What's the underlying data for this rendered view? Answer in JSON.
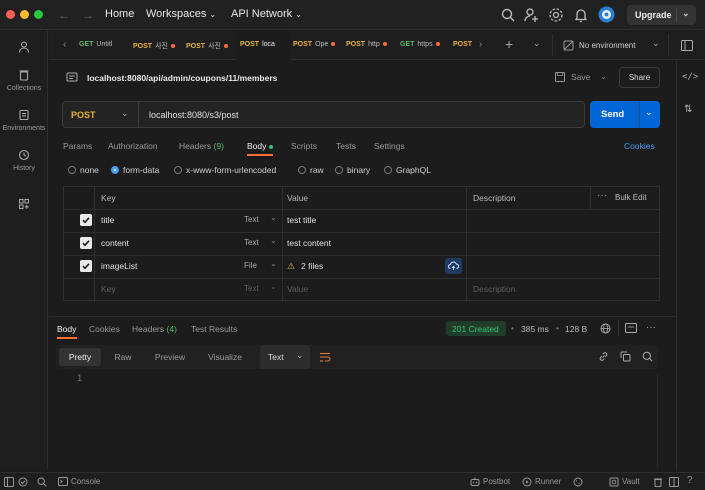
{
  "titlebar": {
    "home": "Home",
    "workspaces": "Workspaces",
    "api_network": "API Network",
    "upgrade": "Upgrade"
  },
  "sidebar": {
    "items": [
      {
        "label": ""
      },
      {
        "label": "Collections"
      },
      {
        "label": "Environments"
      },
      {
        "label": "History"
      },
      {
        "label": ""
      }
    ]
  },
  "tabs": [
    {
      "method": "GET",
      "title": "Untitl",
      "dot": false
    },
    {
      "method": "POST",
      "title": "사진",
      "dot": true
    },
    {
      "method": "POST",
      "title": "사진",
      "dot": true
    },
    {
      "method": "POST",
      "title": "loca",
      "dot": false
    },
    {
      "method": "POST",
      "title": "Ope",
      "dot": true
    },
    {
      "method": "POST",
      "title": "http",
      "dot": true
    },
    {
      "method": "GET",
      "title": "https",
      "dot": true
    },
    {
      "method": "POST",
      "title": "",
      "dot": false
    }
  ],
  "environment": "No environment",
  "request": {
    "path": "localhost:8080/api/admin/coupons/11/members",
    "save": "Save",
    "share": "Share",
    "method": "POST",
    "url": "localhost:8080/s3/post",
    "send": "Send"
  },
  "request_tabs": {
    "params": "Params",
    "authorization": "Authorization",
    "headers": "Headers",
    "headers_count": "(9)",
    "body": "Body",
    "scripts": "Scripts",
    "tests": "Tests",
    "settings": "Settings",
    "cookies": "Cookies"
  },
  "body_types": [
    "none",
    "form-data",
    "x-www-form-urlencoded",
    "raw",
    "binary",
    "GraphQL"
  ],
  "body_selected": "form-data",
  "form_table": {
    "headers": {
      "key": "Key",
      "value": "Value",
      "description": "Description",
      "bulk_edit": "Bulk Edit"
    },
    "rows": [
      {
        "key": "title",
        "type": "Text",
        "value": "test title"
      },
      {
        "key": "content",
        "type": "Text",
        "value": "test content"
      },
      {
        "key": "imageList",
        "type": "File",
        "value": "2 files"
      }
    ],
    "placeholder": {
      "key": "Key",
      "type": "Text",
      "value": "Value",
      "description": "Description"
    }
  },
  "response": {
    "tabs": {
      "body": "Body",
      "cookies": "Cookies",
      "headers": "Headers",
      "headers_count": "(4)",
      "test_results": "Test Results"
    },
    "status": "201 Created",
    "time": "385 ms",
    "size": "128 B",
    "views": [
      "Pretty",
      "Raw",
      "Preview",
      "Visualize"
    ],
    "format": "Text",
    "line_number": "1"
  },
  "footer": {
    "console": "Console",
    "postbot": "Postbot",
    "runner": "Runner",
    "vault": "Vault"
  },
  "colors": {
    "accent": "#ff6c37",
    "send": "#0066d6",
    "post": "#e8b33c",
    "get": "#5fb86f",
    "status_ok": "#3bbf6e"
  }
}
